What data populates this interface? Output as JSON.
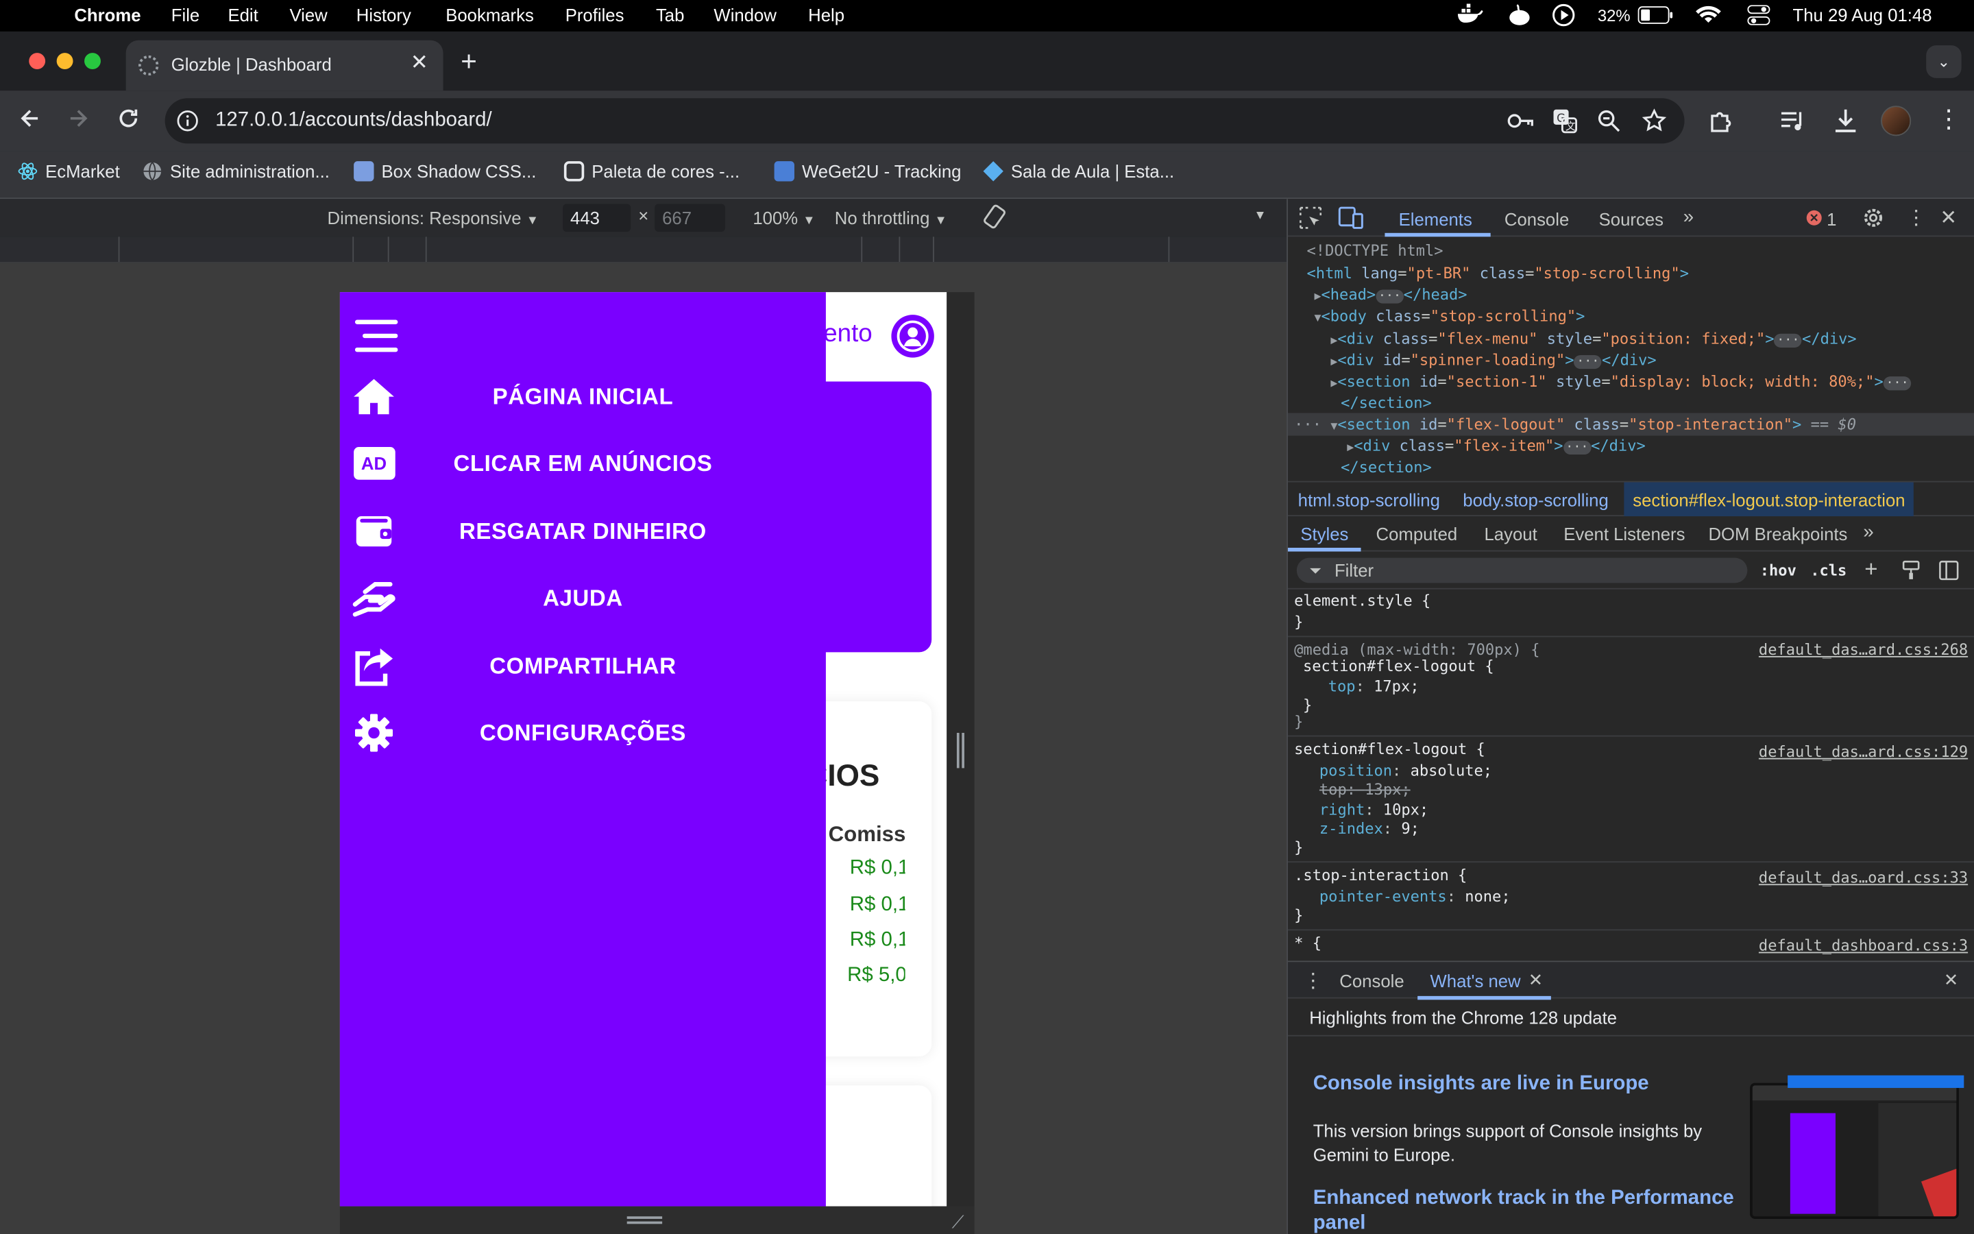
{
  "menubar": {
    "app": "Chrome",
    "items": [
      "File",
      "Edit",
      "View",
      "History",
      "Bookmarks",
      "Profiles",
      "Tab",
      "Window",
      "Help"
    ],
    "battery": "32%",
    "clock": "Thu 29 Aug  01:48"
  },
  "tab": {
    "title": "Glozble | Dashboard"
  },
  "address": {
    "url": "127.0.0.1/accounts/dashboard/"
  },
  "bookmarks": [
    {
      "label": "EcMarket",
      "color": "#61dafb"
    },
    {
      "label": "Site administration...",
      "color": "#9aa0a6"
    },
    {
      "label": "Box Shadow CSS...",
      "color": "#7c9ee0"
    },
    {
      "label": "Paleta de cores -...",
      "color": "#e8eaed"
    },
    {
      "label": "WeGet2U - Tracking",
      "color": "#4a7fd6"
    },
    {
      "label": "Sala de Aula | Esta...",
      "color": "#5ab0f0"
    }
  ],
  "device_toolbar": {
    "dimensions": "Dimensions: Responsive",
    "width": "443",
    "height": "667",
    "zoom": "100%",
    "throttling": "No throttling"
  },
  "page": {
    "header_partial": "ento",
    "heading_partial": "CIOS",
    "col_header_partial": "Comiss",
    "values": [
      "R$ 0,1",
      "R$ 0,1",
      "R$ 0,1",
      "R$ 5,0"
    ],
    "menu": [
      {
        "label": "PÁGINA INICIAL",
        "icon": "home-icon"
      },
      {
        "label": "CLICAR EM ANÚNCIOS",
        "icon": "ad-icon"
      },
      {
        "label": "RESGATAR DINHEIRO",
        "icon": "wallet-icon"
      },
      {
        "label": "AJUDA",
        "icon": "hand-icon"
      },
      {
        "label": "COMPARTILHAR",
        "icon": "share-icon"
      },
      {
        "label": "CONFIGURAÇÕES",
        "icon": "gear-icon"
      }
    ],
    "ad_icon_text": "AD",
    "accent": "#7a00ff"
  },
  "devtools": {
    "tabs": [
      "Elements",
      "Console",
      "Sources"
    ],
    "error_count": "1",
    "dom": {
      "doctype": "<!DOCTYPE html>",
      "html_open": [
        "<html",
        " lang",
        "=\"",
        "pt-BR",
        "\"",
        " class",
        "=\"",
        "stop-scrolling",
        "\">"
      ],
      "head": "<head>",
      "head_close": "</head>",
      "body_open_tag": "<body",
      "body_class": "stop-scrolling",
      "div1_class": "flex-menu",
      "div1_style": "position: fixed;",
      "div2_id": "spinner-loading",
      "section1_id": "section-1",
      "section1_style": "display: block; width: 80%;",
      "section_close": "</section>",
      "logout_id": "flex-logout",
      "logout_class": "stop-interaction",
      "selected_marker": "== $0",
      "flex_item_class": "flex-item",
      "div_close": "</div>"
    },
    "breadcrumbs": [
      "html.stop-scrolling",
      "body.stop-scrolling",
      "section#flex-logout.stop-interaction"
    ],
    "subtabs": [
      "Styles",
      "Computed",
      "Layout",
      "Event Listeners",
      "DOM Breakpoints"
    ],
    "filter_placeholder": "Filter",
    "hov": ":hov",
    "cls": ".cls",
    "styles": {
      "element_style": "element.style {",
      "close": "}",
      "media": "@media",
      "media_query": "(max-width: 700px) {",
      "rule1_selector": "section#flex-logout {",
      "rule1_link": "default_das…ard.css:268",
      "rule1_prop": "top",
      "rule1_val": "17px;",
      "rule2_selector": "section#flex-logout {",
      "rule2_link": "default_das…ard.css:129",
      "rule2_props": [
        {
          "p": "position",
          "v": "absolute;"
        },
        {
          "p": "top",
          "v": "13px;"
        },
        {
          "p": "right",
          "v": "10px;"
        },
        {
          "p": "z-index",
          "v": "9;"
        }
      ],
      "rule3_selector": ".stop-interaction {",
      "rule3_link": "default_das…oard.css:33",
      "rule3_prop": "pointer-events",
      "rule3_val": "none;",
      "rule4_selector": "* {",
      "rule4_link": "default_dashboard.css:3"
    },
    "drawer": {
      "tabs": [
        "Console",
        "What's new"
      ],
      "highlight": "Highlights from the Chrome 128 update",
      "h1": "Console insights are live in Europe",
      "p1": "This version brings support of Console insights by Gemini to Europe.",
      "h2": "Enhanced network track in the Performance panel"
    }
  }
}
